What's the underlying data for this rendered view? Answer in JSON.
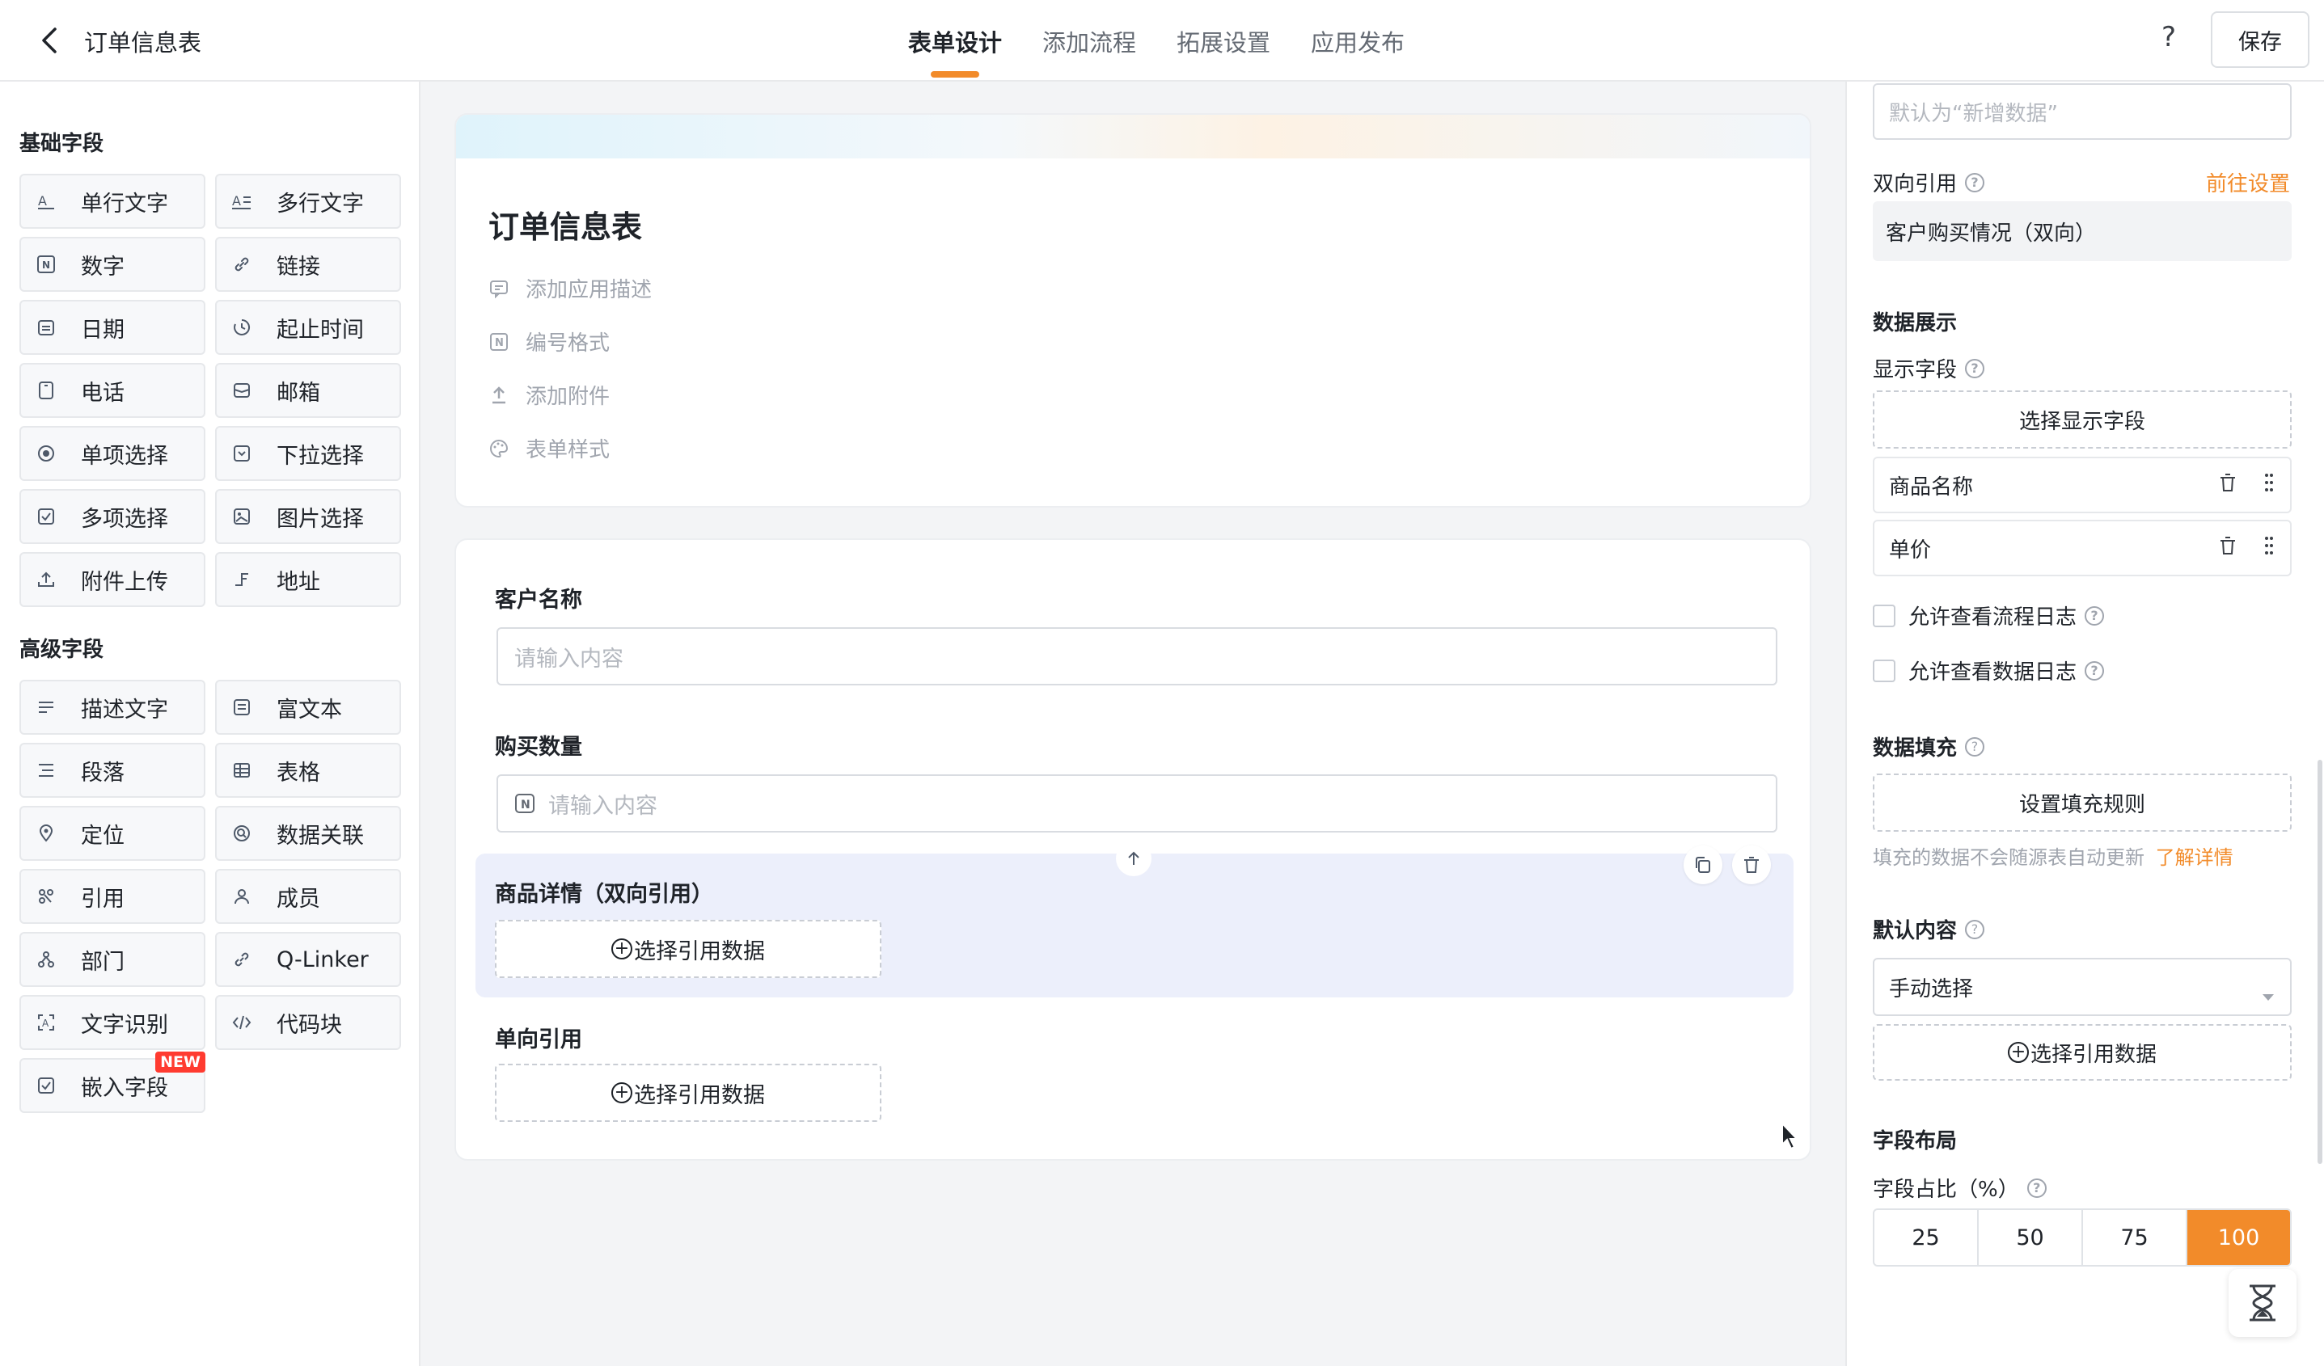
{
  "header": {
    "title": "订单信息表",
    "tabs": [
      "表单设计",
      "添加流程",
      "拓展设置",
      "应用发布"
    ],
    "active_tab": "表单设计",
    "help": "?",
    "save_label": "保存"
  },
  "left_panel": {
    "basic_title": "基础字段",
    "basic_fields": [
      {
        "label": "单行文字",
        "icon": "single-line-text-icon"
      },
      {
        "label": "多行文字",
        "icon": "multi-line-text-icon"
      },
      {
        "label": "数字",
        "icon": "number-icon"
      },
      {
        "label": "链接",
        "icon": "link-icon"
      },
      {
        "label": "日期",
        "icon": "calendar-icon"
      },
      {
        "label": "起止时间",
        "icon": "time-range-icon"
      },
      {
        "label": "电话",
        "icon": "phone-icon"
      },
      {
        "label": "邮箱",
        "icon": "mail-icon"
      },
      {
        "label": "单项选择",
        "icon": "radio-icon"
      },
      {
        "label": "下拉选择",
        "icon": "dropdown-icon"
      },
      {
        "label": "多项选择",
        "icon": "checkbox-icon"
      },
      {
        "label": "图片选择",
        "icon": "image-icon"
      },
      {
        "label": "附件上传",
        "icon": "upload-icon"
      },
      {
        "label": "地址",
        "icon": "address-icon"
      }
    ],
    "advanced_title": "高级字段",
    "advanced_fields": [
      {
        "label": "描述文字",
        "icon": "description-icon"
      },
      {
        "label": "富文本",
        "icon": "rich-text-icon"
      },
      {
        "label": "段落",
        "icon": "paragraph-icon"
      },
      {
        "label": "表格",
        "icon": "table-icon"
      },
      {
        "label": "定位",
        "icon": "location-icon"
      },
      {
        "label": "数据关联",
        "icon": "data-link-icon"
      },
      {
        "label": "引用",
        "icon": "reference-icon"
      },
      {
        "label": "成员",
        "icon": "member-icon"
      },
      {
        "label": "部门",
        "icon": "department-icon"
      },
      {
        "label": "Q-Linker",
        "icon": "q-linker-icon"
      },
      {
        "label": "文字识别",
        "icon": "ocr-icon"
      },
      {
        "label": "代码块",
        "icon": "code-icon"
      },
      {
        "label": "嵌入字段",
        "icon": "embed-icon",
        "badge": "NEW"
      }
    ]
  },
  "form": {
    "title": "订单信息表",
    "meta": [
      {
        "label": "添加应用描述",
        "icon": "comment-icon"
      },
      {
        "label": "编号格式",
        "icon": "number-format-icon"
      },
      {
        "label": "添加附件",
        "icon": "attachment-upload-icon"
      },
      {
        "label": "表单样式",
        "icon": "palette-icon"
      }
    ],
    "fields": {
      "customer_name": {
        "label": "客户名称",
        "placeholder": "请输入内容"
      },
      "quantity": {
        "label": "购买数量",
        "placeholder": "请输入内容"
      },
      "product_detail": {
        "label": "商品详情（双向引用）",
        "button": "选择引用数据"
      },
      "one_way_ref": {
        "label": "单向引用",
        "button": "选择引用数据"
      }
    }
  },
  "right_panel": {
    "title_input_placeholder": "默认为“新增数据”",
    "bidirectional_label": "双向引用",
    "goto_settings": "前往设置",
    "bidirectional_value": "客户购买情况（双向）",
    "data_display_title": "数据展示",
    "display_fields_label": "显示字段",
    "choose_display_fields": "选择显示字段",
    "display_items": [
      "商品名称",
      "单价"
    ],
    "allow_flow_log": "允许查看流程日志",
    "allow_data_log": "允许查看数据日志",
    "data_fill_title": "数据填充",
    "set_fill_rules": "设置填充规则",
    "fill_note": "填充的数据不会随源表自动更新",
    "learn_more": "了解详情",
    "default_content_title": "默认内容",
    "default_mode": "手动选择",
    "choose_ref_data": "选择引用数据",
    "layout_title": "字段布局",
    "ratio_label": "字段占比（%）",
    "ratio_options": [
      "25",
      "50",
      "75",
      "100"
    ],
    "ratio_selected": "100"
  },
  "colors": {
    "accent": "#f28b2a",
    "selected_block": "#eceffb",
    "header_gradient_left": "#dff3fb",
    "header_gradient_mid": "#fdf2e4"
  }
}
